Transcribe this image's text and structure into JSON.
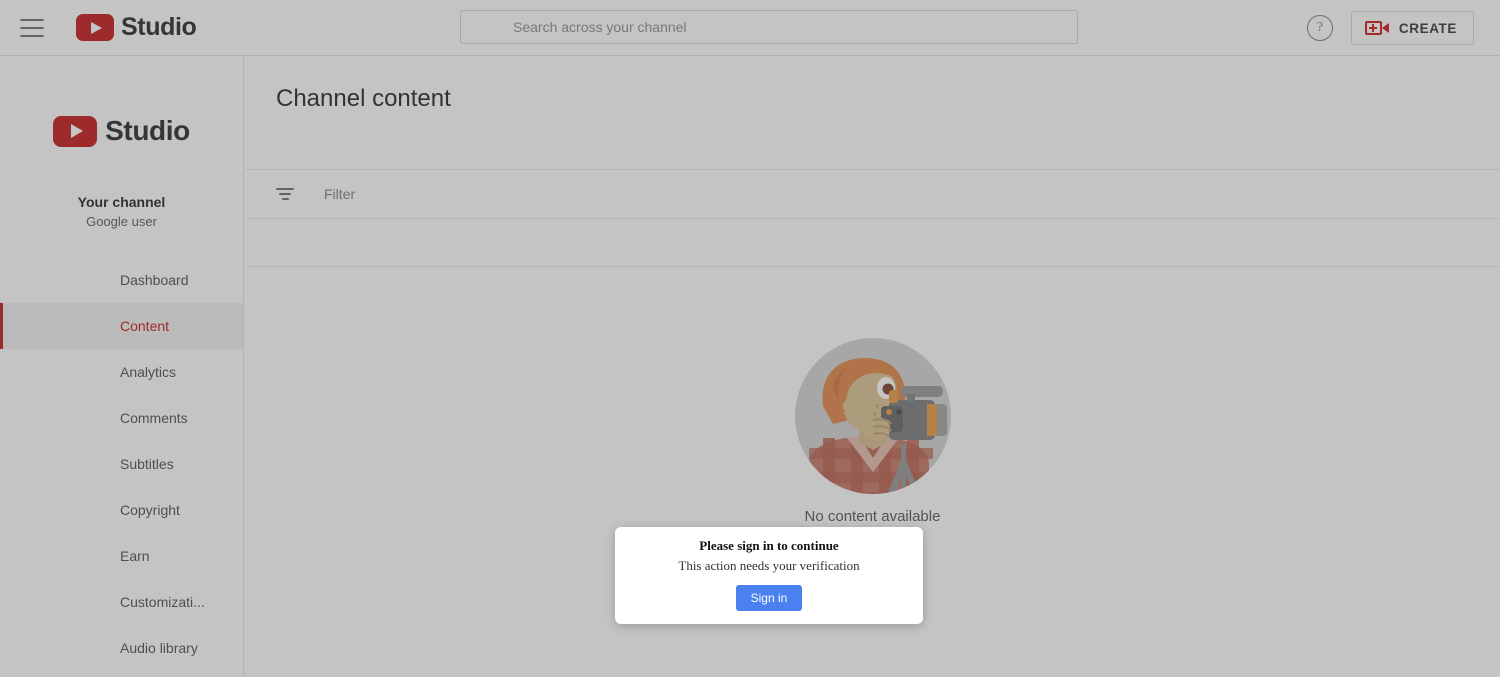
{
  "header": {
    "menu_icon": "hamburger-icon",
    "brand": "Studio",
    "search": {
      "placeholder": "Search across your channel",
      "value": ""
    },
    "help_glyph": "?",
    "create_label": "CREATE",
    "create_icon": "video-camera-plus-icon"
  },
  "sidebar": {
    "brand": "Studio",
    "channel_name": "Your channel",
    "channel_sub": "Google user",
    "items": [
      {
        "label": "Dashboard",
        "active": false
      },
      {
        "label": "Content",
        "active": true
      },
      {
        "label": "Analytics",
        "active": false
      },
      {
        "label": "Comments",
        "active": false
      },
      {
        "label": "Subtitles",
        "active": false
      },
      {
        "label": "Copyright",
        "active": false
      },
      {
        "label": "Earn",
        "active": false
      },
      {
        "label": "Customizati...",
        "active": false
      },
      {
        "label": "Audio library",
        "active": false
      }
    ]
  },
  "main": {
    "title": "Channel content",
    "filter": {
      "icon": "filter-icon",
      "placeholder": "Filter"
    },
    "empty_state": {
      "illustration": "person-filming-with-camcorder-illustration",
      "message": "No content available",
      "action_label": ""
    }
  },
  "modal": {
    "title": "Please sign in to continue",
    "subtitle": "This action needs your verification",
    "button_label": "Sign in"
  },
  "colors": {
    "brand_red": "#c00000",
    "create_red": "#cc0000",
    "active_red": "#c00000",
    "signin_blue": "#4a80f0",
    "action_blue": "#1b3d8a",
    "scrim": "rgba(107,107,107,0.40)"
  }
}
